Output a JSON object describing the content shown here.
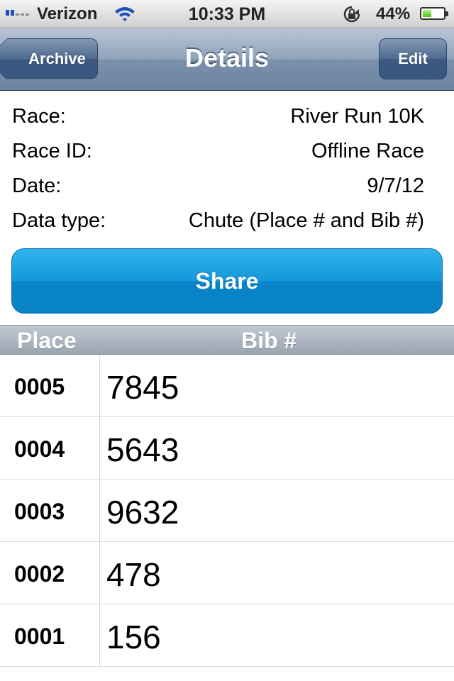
{
  "status_bar": {
    "carrier": "Verizon",
    "time": "10:33 PM",
    "battery_percent": "44%",
    "battery_level": 0.44,
    "signal_bars": 2,
    "icons": [
      "signal-bars-icon",
      "wifi-icon",
      "rotation-lock-icon",
      "battery-icon"
    ]
  },
  "nav": {
    "back_label": "Archive",
    "title": "Details",
    "edit_label": "Edit"
  },
  "details": {
    "race_label": "Race:",
    "race_value": "River Run 10K",
    "race_id_label": "Race ID:",
    "race_id_value": "Offline Race",
    "date_label": "Date:",
    "date_value": "9/7/12",
    "data_type_label": "Data type:",
    "data_type_value": "Chute (Place # and Bib #)"
  },
  "share_label": "Share",
  "table": {
    "headers": {
      "place": "Place",
      "bib": "Bib #"
    },
    "rows": [
      {
        "place": "0005",
        "bib": "7845"
      },
      {
        "place": "0004",
        "bib": "5643"
      },
      {
        "place": "0003",
        "bib": "9632"
      },
      {
        "place": "0002",
        "bib": "478"
      },
      {
        "place": "0001",
        "bib": "156"
      }
    ]
  },
  "colors": {
    "nav_bar": "#7a90ab",
    "share_button": "#1398da",
    "table_header": "#a9b3be"
  }
}
